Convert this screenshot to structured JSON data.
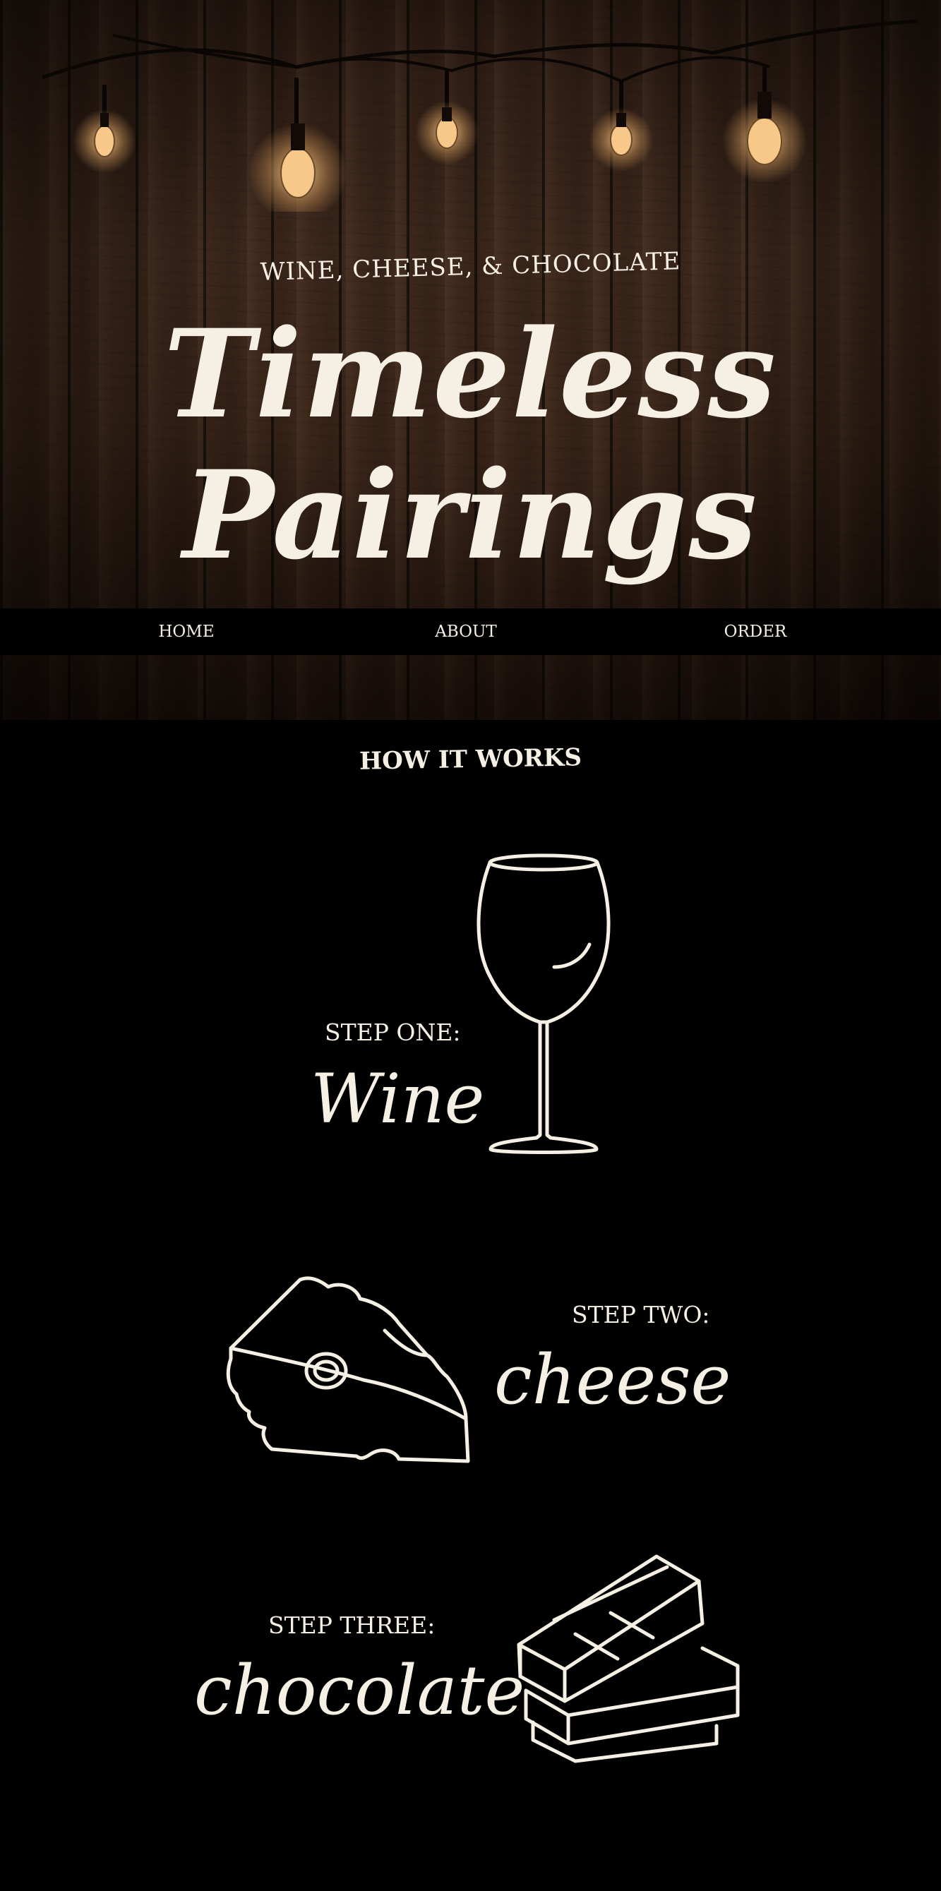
{
  "hero": {
    "tagline": "WINE, CHEESE, & CHOCOLATE",
    "title": "Timeless Pairings"
  },
  "nav": {
    "items": [
      {
        "label": "HOME"
      },
      {
        "label": "ABOUT"
      },
      {
        "label": "ORDER"
      }
    ]
  },
  "how_it_works": {
    "title": "HOW IT WORKS",
    "steps": [
      {
        "label": "STEP ONE:",
        "word": "Wine",
        "icon": "wine-glass-icon"
      },
      {
        "label": "STEP TWO:",
        "word": "cheese",
        "icon": "cheese-wedge-icon"
      },
      {
        "label": "STEP THREE:",
        "word": "chocolate",
        "icon": "chocolate-bars-icon"
      }
    ]
  },
  "colors": {
    "background": "#000000",
    "text": "#f6efe3",
    "wood": "#3d281c",
    "bulb_glow": "#f2b36a"
  }
}
